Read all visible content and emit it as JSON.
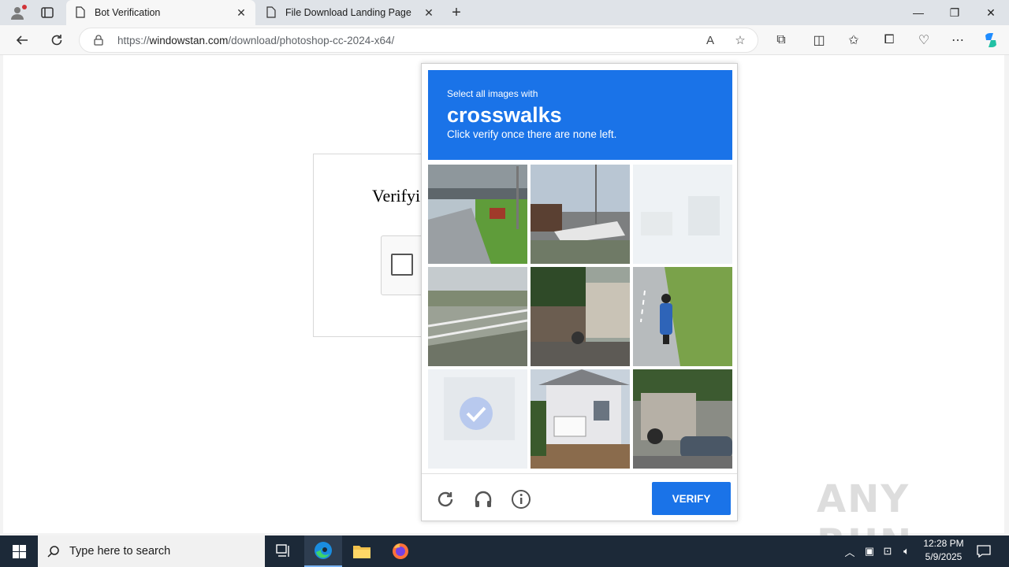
{
  "browser": {
    "tabs": [
      {
        "label": "Bot Verification",
        "active": true
      },
      {
        "label": "File Download Landing Page",
        "active": false
      }
    ],
    "address": {
      "scheme": "https://",
      "host": "windowstan.com",
      "path": "/download/photoshop-cc-2024-x64/"
    }
  },
  "page": {
    "heading": "Verifyi"
  },
  "challenge": {
    "instruction_small": "Select all images with",
    "target_word": "crosswalks",
    "instruction_sub": "Click verify once there are none left.",
    "tiles": [
      {
        "name": "tile-overpass-road",
        "selected": false
      },
      {
        "name": "tile-boats-dock",
        "selected": false
      },
      {
        "name": "tile-faded",
        "selected": false
      },
      {
        "name": "tile-bridge-railing",
        "selected": false
      },
      {
        "name": "tile-street-houses",
        "selected": false
      },
      {
        "name": "tile-motorcycle-road",
        "selected": false
      },
      {
        "name": "tile-selected",
        "selected": true
      },
      {
        "name": "tile-house-balcony",
        "selected": false
      },
      {
        "name": "tile-scooter-car",
        "selected": false
      }
    ],
    "verify_label": "VERIFY",
    "accent": "#1a73e8"
  },
  "watermark": "ANY RUN",
  "taskbar": {
    "search_placeholder": "Type here to search",
    "time": "12:28 PM",
    "date": "5/9/2025"
  }
}
